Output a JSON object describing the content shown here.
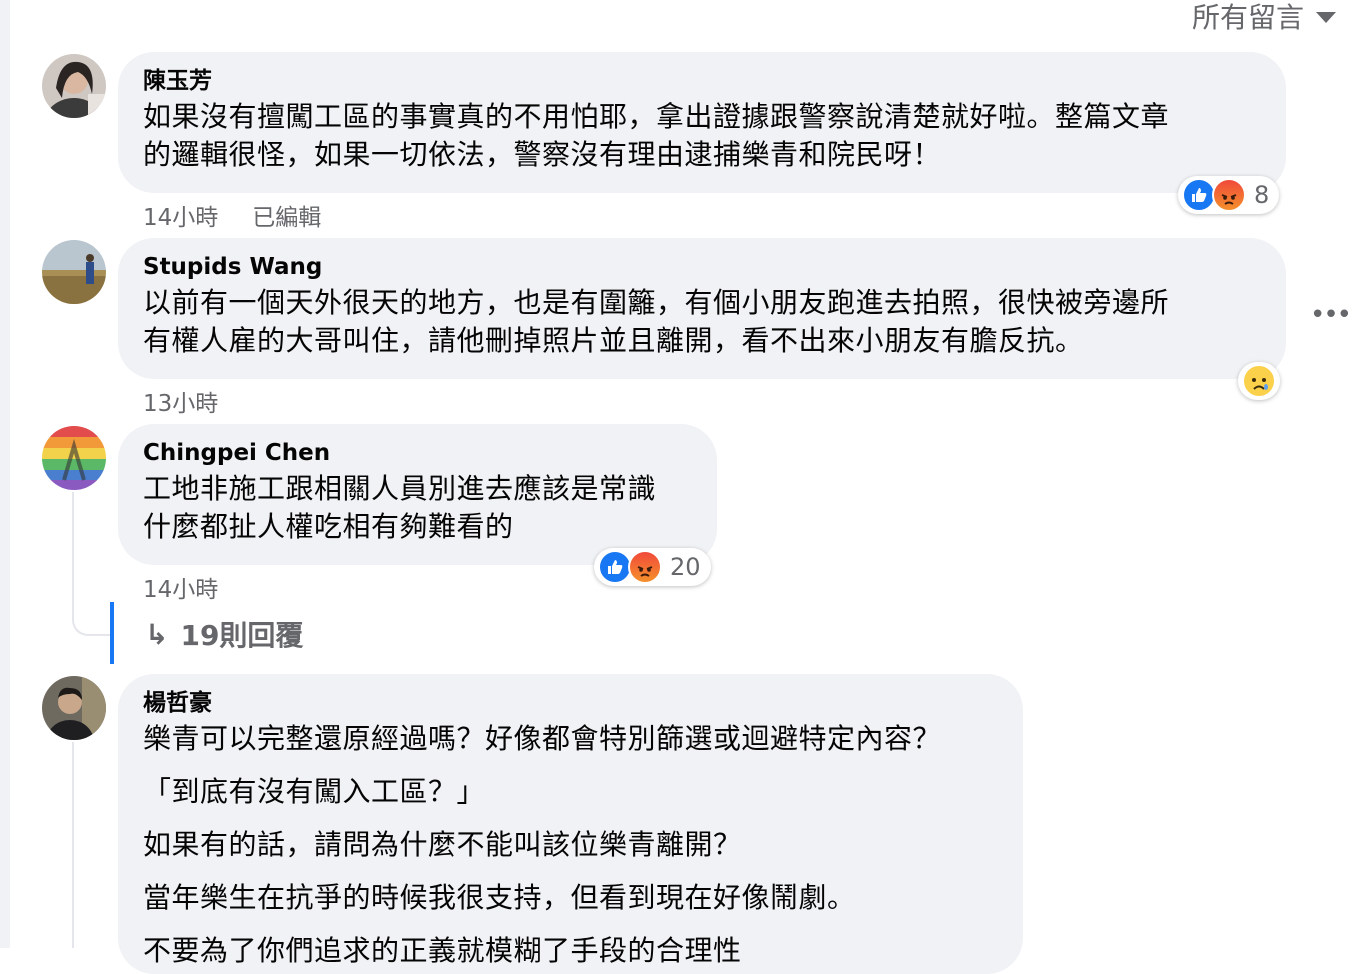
{
  "sort": {
    "label": "所有留言"
  },
  "comments": [
    {
      "name": "陳玉芳",
      "lines": [
        "如果沒有擅闖工區的事實真的不用怕耶，拿出證據跟警察說清楚就好啦。整篇文章",
        "的邏輯很怪，如果一切依法，警察沒有理由逮捕樂青和院民呀！"
      ],
      "time": "14小時",
      "edited": "已編輯",
      "reactions": [
        "like",
        "angry"
      ],
      "reaction_count": "8"
    },
    {
      "name": "Stupids Wang",
      "lines": [
        "以前有一個天外很天的地方，也是有圍籬，有個小朋友跑進去拍照，很快被旁邊所",
        "有權人雇的大哥叫住，請他刪掉照片並且離開，看不出來小朋友有膽反抗。"
      ],
      "time": "13小時",
      "reactions": [
        "sad"
      ]
    },
    {
      "name": "Chingpei Chen",
      "lines": [
        "工地非施工跟相關人員別進去應該是常識",
        "什麼都扯人權吃相有夠難看的"
      ],
      "time": "14小時",
      "reactions": [
        "like",
        "angry"
      ],
      "reaction_count": "20",
      "replies_label": "19則回覆"
    },
    {
      "name": "楊哲豪",
      "paragraphs": [
        "樂青可以完整還原經過嗎？好像都會特別篩選或迴避特定內容？",
        "「到底有沒有闖入工區？」",
        "如果有的話，請問為什麼不能叫該位樂青離開？",
        "當年樂生在抗爭的時候我很支持，但看到現在好像鬧劇。",
        "不要為了你們追求的正義就模糊了手段的合理性"
      ]
    }
  ],
  "colors": {
    "bubble": "#f0f2f5",
    "meta": "#65676b",
    "like": "#1877f2",
    "reply_bar": "#1877f2"
  }
}
